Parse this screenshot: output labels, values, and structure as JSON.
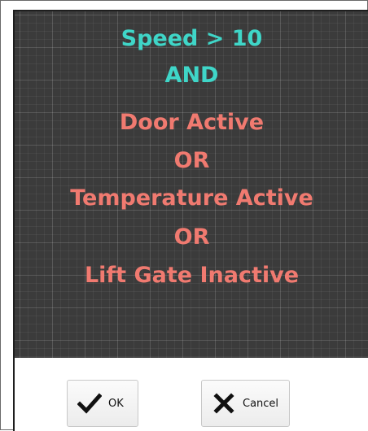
{
  "rule": {
    "lines": [
      {
        "text": "Speed > 10",
        "color": "#3fd6c8"
      },
      {
        "text": "AND",
        "color": "#3fd6c8"
      },
      {
        "text": "Door Active",
        "color": "#f07a70"
      },
      {
        "text": "OR",
        "color": "#f07a70"
      },
      {
        "text": "Temperature Active",
        "color": "#f07a70"
      },
      {
        "text": "OR",
        "color": "#f07a70"
      },
      {
        "text": "Lift Gate Inactive",
        "color": "#f07a70"
      }
    ],
    "canvas_color": "#3b3b3b",
    "grid": true
  },
  "buttons": {
    "ok": {
      "label": "OK",
      "icon": "checkmark-icon"
    },
    "cancel": {
      "label": "Cancel",
      "icon": "close-icon"
    }
  }
}
